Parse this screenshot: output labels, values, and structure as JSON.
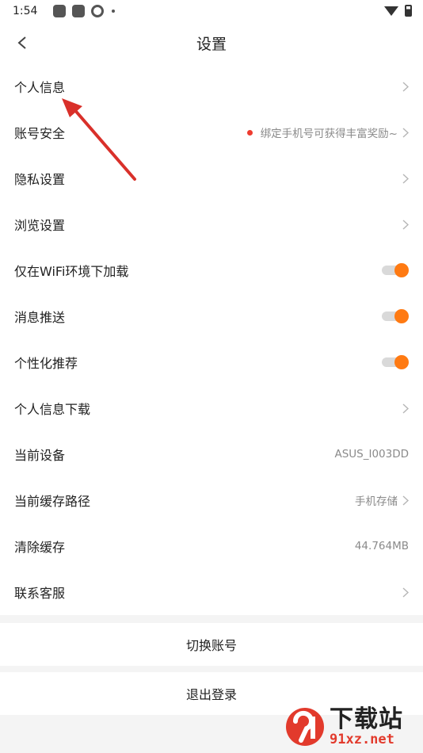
{
  "status_bar": {
    "time": "1:54"
  },
  "header": {
    "title": "设置"
  },
  "settings": [
    {
      "label": "个人信息",
      "type": "link",
      "value": ""
    },
    {
      "label": "账号安全",
      "type": "link",
      "value": "绑定手机号可获得丰富奖励~",
      "badge": true
    },
    {
      "label": "隐私设置",
      "type": "link",
      "value": ""
    },
    {
      "label": "浏览设置",
      "type": "link",
      "value": ""
    },
    {
      "label": "仅在WiFi环境下加载",
      "type": "toggle",
      "on": true
    },
    {
      "label": "消息推送",
      "type": "toggle",
      "on": true
    },
    {
      "label": "个性化推荐",
      "type": "toggle",
      "on": true
    },
    {
      "label": "个人信息下载",
      "type": "link",
      "value": ""
    },
    {
      "label": "当前设备",
      "type": "value",
      "value": "ASUS_I003DD"
    },
    {
      "label": "当前缓存路径",
      "type": "link",
      "value": "手机存储"
    },
    {
      "label": "清除缓存",
      "type": "value",
      "value": "44.764MB"
    },
    {
      "label": "联系客服",
      "type": "link",
      "value": ""
    }
  ],
  "actions": {
    "switch_account": "切换账号",
    "logout": "退出登录"
  },
  "watermark": {
    "title": "下载站",
    "domain": "91xz.net"
  },
  "colors": {
    "accent": "#ff7a12",
    "badge": "#ee3b2f",
    "annotation_arrow": "#d9302a"
  }
}
